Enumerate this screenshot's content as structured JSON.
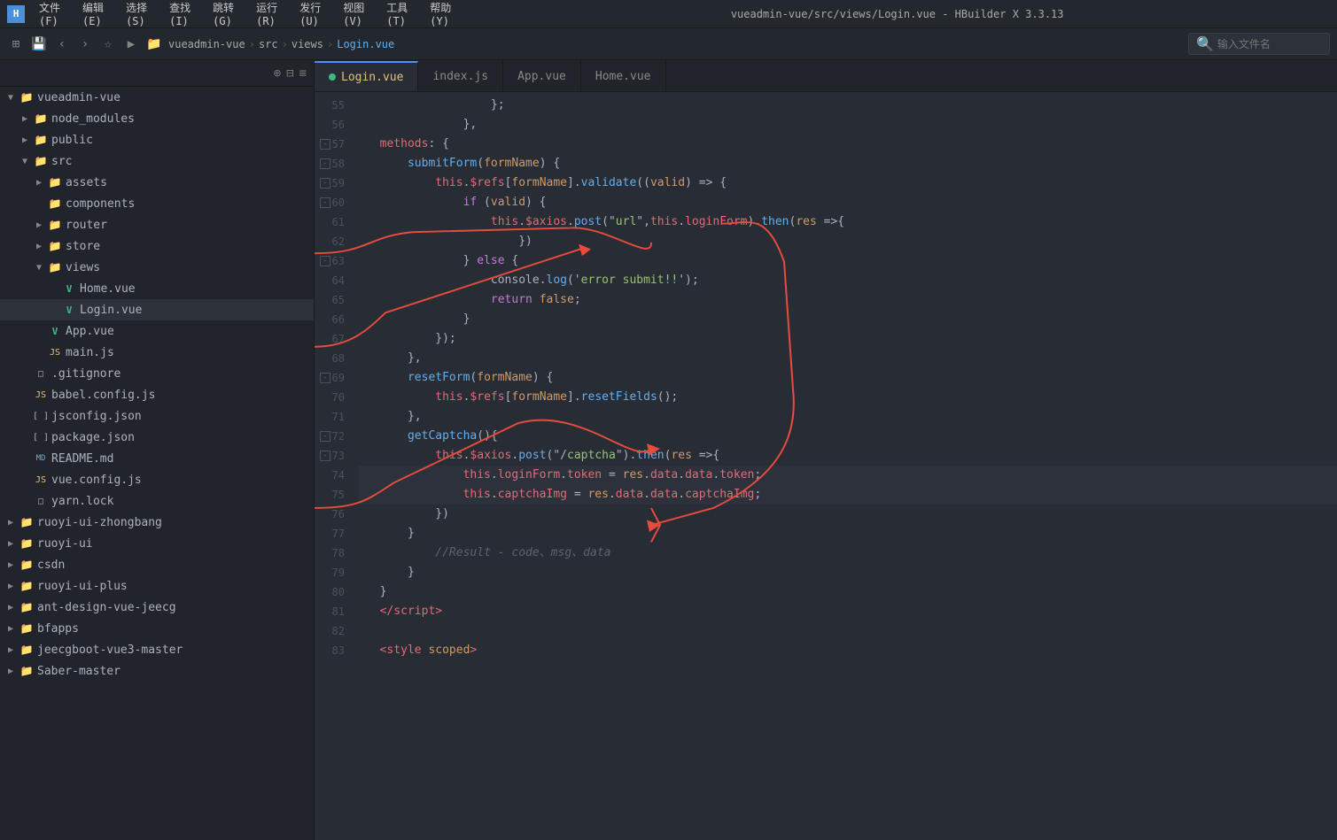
{
  "titlebar": {
    "logo": "H",
    "menu_items": [
      "文件(F)",
      "编辑(E)",
      "选择(S)",
      "查找(I)",
      "跳转(G)",
      "运行(R)",
      "发行(U)",
      "视图(V)",
      "工具(T)",
      "帮助(Y)"
    ],
    "title": "vueadmin-vue/src/views/Login.vue - HBuilder X 3.3.13"
  },
  "toolbar": {
    "breadcrumbs": [
      "vueadmin-vue",
      "src",
      "views",
      "Login.vue"
    ],
    "search_placeholder": "输入文件名"
  },
  "sidebar": {
    "root": "vueadmin-vue",
    "items": [
      {
        "id": "node_modules",
        "label": "node_modules",
        "type": "folder",
        "depth": 1,
        "expanded": false
      },
      {
        "id": "public",
        "label": "public",
        "type": "folder",
        "depth": 1,
        "expanded": false
      },
      {
        "id": "src",
        "label": "src",
        "type": "folder",
        "depth": 1,
        "expanded": true
      },
      {
        "id": "assets",
        "label": "assets",
        "type": "folder",
        "depth": 2,
        "expanded": false
      },
      {
        "id": "components",
        "label": "components",
        "type": "folder",
        "depth": 2,
        "expanded": false
      },
      {
        "id": "router",
        "label": "router",
        "type": "folder",
        "depth": 2,
        "expanded": false
      },
      {
        "id": "store",
        "label": "store",
        "type": "folder",
        "depth": 2,
        "expanded": false
      },
      {
        "id": "views",
        "label": "views",
        "type": "folder",
        "depth": 2,
        "expanded": true
      },
      {
        "id": "Home.vue",
        "label": "Home.vue",
        "type": "vue",
        "depth": 3
      },
      {
        "id": "Login.vue",
        "label": "Login.vue",
        "type": "vue",
        "depth": 3,
        "active": true
      },
      {
        "id": "App.vue",
        "label": "App.vue",
        "type": "vue",
        "depth": 2
      },
      {
        "id": "main.js",
        "label": "main.js",
        "type": "js",
        "depth": 2
      },
      {
        "id": ".gitignore",
        "label": ".gitignore",
        "type": "file",
        "depth": 1
      },
      {
        "id": "babel.config.js",
        "label": "babel.config.js",
        "type": "js",
        "depth": 1
      },
      {
        "id": "jsconfig.json",
        "label": "jsconfig.json",
        "type": "json",
        "depth": 1
      },
      {
        "id": "package.json",
        "label": "package.json",
        "type": "json",
        "depth": 1
      },
      {
        "id": "README.md",
        "label": "README.md",
        "type": "md",
        "depth": 1
      },
      {
        "id": "vue.config.js",
        "label": "vue.config.js",
        "type": "js",
        "depth": 1
      },
      {
        "id": "yarn.lock",
        "label": "yarn.lock",
        "type": "file",
        "depth": 1
      },
      {
        "id": "ruoyi-ui-zhongbang",
        "label": "ruoyi-ui-zhongbang",
        "type": "folder",
        "depth": 0,
        "expanded": false
      },
      {
        "id": "ruoyi-ui",
        "label": "ruoyi-ui",
        "type": "folder",
        "depth": 0,
        "expanded": false
      },
      {
        "id": "csdn",
        "label": "csdn",
        "type": "folder",
        "depth": 0,
        "expanded": false
      },
      {
        "id": "ruoyi-ui-plus",
        "label": "ruoyi-ui-plus",
        "type": "folder",
        "depth": 0,
        "expanded": false
      },
      {
        "id": "ant-design-vue-jeecg",
        "label": "ant-design-vue-jeecg",
        "type": "folder",
        "depth": 0,
        "expanded": false
      },
      {
        "id": "bfapps",
        "label": "bfapps",
        "type": "folder",
        "depth": 0,
        "expanded": false
      },
      {
        "id": "jeecgboot-vue3-master",
        "label": "jeecgboot-vue3-master",
        "type": "folder",
        "depth": 0,
        "expanded": false
      },
      {
        "id": "Saber-master",
        "label": "Saber-master",
        "type": "folder",
        "depth": 0,
        "expanded": false
      }
    ]
  },
  "tabs": [
    {
      "label": "Login.vue",
      "active": true,
      "type": "vue"
    },
    {
      "label": "index.js",
      "active": false,
      "type": "js"
    },
    {
      "label": "App.vue",
      "active": false,
      "type": "vue"
    },
    {
      "label": "Home.vue",
      "active": false,
      "type": "vue"
    }
  ],
  "code": {
    "lines": [
      {
        "num": 55,
        "collapse": false,
        "tokens": [
          {
            "t": "                  ",
            "c": "plain"
          },
          {
            "t": "}",
            "c": "punct"
          },
          {
            "t": ";",
            "c": "punct"
          }
        ]
      },
      {
        "num": 56,
        "collapse": false,
        "tokens": [
          {
            "t": "              ",
            "c": "plain"
          },
          {
            "t": "}",
            "c": "punct"
          },
          {
            "t": ",",
            "c": "punct"
          }
        ]
      },
      {
        "num": 57,
        "collapse": true,
        "tokens": [
          {
            "t": "  ",
            "c": "plain"
          },
          {
            "t": "methods",
            "c": "prop"
          },
          {
            "t": ": {",
            "c": "plain"
          }
        ]
      },
      {
        "num": 58,
        "collapse": true,
        "tokens": [
          {
            "t": "      ",
            "c": "plain"
          },
          {
            "t": "submitForm",
            "c": "fn"
          },
          {
            "t": "(",
            "c": "punct"
          },
          {
            "t": "formName",
            "c": "param"
          },
          {
            "t": ") {",
            "c": "plain"
          }
        ]
      },
      {
        "num": 59,
        "collapse": true,
        "tokens": [
          {
            "t": "          ",
            "c": "plain"
          },
          {
            "t": "this",
            "c": "this-kw"
          },
          {
            "t": ".",
            "c": "punct"
          },
          {
            "t": "$refs",
            "c": "prop"
          },
          {
            "t": "[",
            "c": "punct"
          },
          {
            "t": "formName",
            "c": "param"
          },
          {
            "t": "].",
            "c": "punct"
          },
          {
            "t": "validate",
            "c": "method"
          },
          {
            "t": "((",
            "c": "punct"
          },
          {
            "t": "valid",
            "c": "param"
          },
          {
            "t": ") => {",
            "c": "plain"
          }
        ]
      },
      {
        "num": 60,
        "collapse": true,
        "tokens": [
          {
            "t": "              ",
            "c": "plain"
          },
          {
            "t": "if",
            "c": "kw"
          },
          {
            "t": " (",
            "c": "punct"
          },
          {
            "t": "valid",
            "c": "param"
          },
          {
            "t": ") {",
            "c": "plain"
          }
        ]
      },
      {
        "num": 61,
        "collapse": false,
        "tokens": [
          {
            "t": "                  ",
            "c": "plain"
          },
          {
            "t": "this",
            "c": "this-kw"
          },
          {
            "t": ".",
            "c": "punct"
          },
          {
            "t": "$axios",
            "c": "prop"
          },
          {
            "t": ".",
            "c": "punct"
          },
          {
            "t": "post",
            "c": "method"
          },
          {
            "t": "(\"",
            "c": "punct"
          },
          {
            "t": "url",
            "c": "str"
          },
          {
            "t": "\",",
            "c": "punct"
          },
          {
            "t": "this",
            "c": "this-kw"
          },
          {
            "t": ".",
            "c": "punct"
          },
          {
            "t": "loginForm",
            "c": "prop"
          },
          {
            "t": ").",
            "c": "punct"
          },
          {
            "t": "then",
            "c": "method"
          },
          {
            "t": "(",
            "c": "punct"
          },
          {
            "t": "res",
            "c": "param"
          },
          {
            "t": " =>{",
            "c": "plain"
          }
        ]
      },
      {
        "num": 62,
        "collapse": false,
        "tokens": [
          {
            "t": "                      ",
            "c": "plain"
          },
          {
            "t": "})",
            "c": "punct"
          }
        ]
      },
      {
        "num": 63,
        "collapse": true,
        "tokens": [
          {
            "t": "              ",
            "c": "plain"
          },
          {
            "t": "} ",
            "c": "punct"
          },
          {
            "t": "else",
            "c": "kw"
          },
          {
            "t": " {",
            "c": "plain"
          }
        ]
      },
      {
        "num": 64,
        "collapse": false,
        "tokens": [
          {
            "t": "                  ",
            "c": "plain"
          },
          {
            "t": "console",
            "c": "plain"
          },
          {
            "t": ".",
            "c": "punct"
          },
          {
            "t": "log",
            "c": "method"
          },
          {
            "t": "('",
            "c": "punct"
          },
          {
            "t": "error submit!!",
            "c": "str"
          },
          {
            "t": "');",
            "c": "punct"
          }
        ]
      },
      {
        "num": 65,
        "collapse": false,
        "tokens": [
          {
            "t": "                  ",
            "c": "plain"
          },
          {
            "t": "return",
            "c": "kw"
          },
          {
            "t": " ",
            "c": "plain"
          },
          {
            "t": "false",
            "c": "bool"
          },
          {
            "t": ";",
            "c": "punct"
          }
        ]
      },
      {
        "num": 66,
        "collapse": false,
        "tokens": [
          {
            "t": "              ",
            "c": "plain"
          },
          {
            "t": "}",
            "c": "punct"
          }
        ]
      },
      {
        "num": 67,
        "collapse": false,
        "tokens": [
          {
            "t": "          ",
            "c": "plain"
          },
          {
            "t": "});",
            "c": "punct"
          }
        ]
      },
      {
        "num": 68,
        "collapse": false,
        "tokens": [
          {
            "t": "      ",
            "c": "plain"
          },
          {
            "t": "},",
            "c": "punct"
          }
        ]
      },
      {
        "num": 69,
        "collapse": true,
        "tokens": [
          {
            "t": "      ",
            "c": "plain"
          },
          {
            "t": "resetForm",
            "c": "fn"
          },
          {
            "t": "(",
            "c": "punct"
          },
          {
            "t": "formName",
            "c": "param"
          },
          {
            "t": ") {",
            "c": "plain"
          }
        ]
      },
      {
        "num": 70,
        "collapse": false,
        "tokens": [
          {
            "t": "          ",
            "c": "plain"
          },
          {
            "t": "this",
            "c": "this-kw"
          },
          {
            "t": ".",
            "c": "punct"
          },
          {
            "t": "$refs",
            "c": "prop"
          },
          {
            "t": "[",
            "c": "punct"
          },
          {
            "t": "formName",
            "c": "param"
          },
          {
            "t": "].",
            "c": "punct"
          },
          {
            "t": "resetFields",
            "c": "method"
          },
          {
            "t": "();",
            "c": "punct"
          }
        ]
      },
      {
        "num": 71,
        "collapse": false,
        "tokens": [
          {
            "t": "      ",
            "c": "plain"
          },
          {
            "t": "},",
            "c": "punct"
          }
        ]
      },
      {
        "num": 72,
        "collapse": true,
        "tokens": [
          {
            "t": "      ",
            "c": "plain"
          },
          {
            "t": "getCaptcha",
            "c": "fn"
          },
          {
            "t": "(){",
            "c": "plain"
          }
        ]
      },
      {
        "num": 73,
        "collapse": true,
        "tokens": [
          {
            "t": "          ",
            "c": "plain"
          },
          {
            "t": "this",
            "c": "this-kw"
          },
          {
            "t": ".",
            "c": "punct"
          },
          {
            "t": "$axios",
            "c": "prop"
          },
          {
            "t": ".",
            "c": "punct"
          },
          {
            "t": "post",
            "c": "method"
          },
          {
            "t": "(\"/",
            "c": "punct"
          },
          {
            "t": "captcha",
            "c": "str"
          },
          {
            "t": "\").",
            "c": "punct"
          },
          {
            "t": "then",
            "c": "method"
          },
          {
            "t": "(",
            "c": "punct"
          },
          {
            "t": "res",
            "c": "param"
          },
          {
            "t": " =>{",
            "c": "plain"
          }
        ]
      },
      {
        "num": 74,
        "collapse": false,
        "tokens": [
          {
            "t": "              ",
            "c": "plain"
          },
          {
            "t": "this",
            "c": "this-kw"
          },
          {
            "t": ".",
            "c": "punct"
          },
          {
            "t": "loginForm",
            "c": "prop"
          },
          {
            "t": ".",
            "c": "punct"
          },
          {
            "t": "token",
            "c": "prop"
          },
          {
            "t": " = ",
            "c": "plain"
          },
          {
            "t": "res",
            "c": "param"
          },
          {
            "t": ".",
            "c": "punct"
          },
          {
            "t": "data",
            "c": "prop"
          },
          {
            "t": ".",
            "c": "punct"
          },
          {
            "t": "data",
            "c": "prop"
          },
          {
            "t": ".",
            "c": "punct"
          },
          {
            "t": "token",
            "c": "prop"
          },
          {
            "t": ";",
            "c": "punct"
          }
        ]
      },
      {
        "num": 75,
        "collapse": false,
        "tokens": [
          {
            "t": "              ",
            "c": "plain"
          },
          {
            "t": "this",
            "c": "this-kw"
          },
          {
            "t": ".",
            "c": "punct"
          },
          {
            "t": "captchaImg",
            "c": "prop"
          },
          {
            "t": " = ",
            "c": "plain"
          },
          {
            "t": "res",
            "c": "param"
          },
          {
            "t": ".",
            "c": "punct"
          },
          {
            "t": "data",
            "c": "prop"
          },
          {
            "t": ".",
            "c": "punct"
          },
          {
            "t": "data",
            "c": "prop"
          },
          {
            "t": ".",
            "c": "punct"
          },
          {
            "t": "captchaImg",
            "c": "prop"
          },
          {
            "t": ";",
            "c": "punct"
          }
        ],
        "active": true
      },
      {
        "num": 76,
        "collapse": false,
        "tokens": [
          {
            "t": "          ",
            "c": "plain"
          },
          {
            "t": "})",
            "c": "punct"
          }
        ]
      },
      {
        "num": 77,
        "collapse": false,
        "tokens": [
          {
            "t": "      ",
            "c": "plain"
          },
          {
            "t": "}",
            "c": "punct"
          }
        ]
      },
      {
        "num": 78,
        "collapse": false,
        "tokens": [
          {
            "t": "          ",
            "c": "plain"
          },
          {
            "t": "//Result - code、msg、data",
            "c": "comment"
          }
        ]
      },
      {
        "num": 79,
        "collapse": false,
        "tokens": [
          {
            "t": "      ",
            "c": "plain"
          },
          {
            "t": "}",
            "c": "punct"
          }
        ]
      },
      {
        "num": 80,
        "collapse": false,
        "tokens": [
          {
            "t": "  ",
            "c": "plain"
          },
          {
            "t": "}",
            "c": "punct"
          }
        ]
      },
      {
        "num": 81,
        "collapse": false,
        "tokens": [
          {
            "t": "  ",
            "c": "plain"
          },
          {
            "t": "</",
            "c": "tag"
          },
          {
            "t": "script",
            "c": "tag"
          },
          {
            "t": ">",
            "c": "tag"
          }
        ]
      },
      {
        "num": 82,
        "collapse": false,
        "tokens": []
      },
      {
        "num": 83,
        "collapse": false,
        "tokens": [
          {
            "t": "  ",
            "c": "plain"
          },
          {
            "t": "<",
            "c": "tag"
          },
          {
            "t": "style",
            "c": "tag"
          },
          {
            "t": " ",
            "c": "plain"
          },
          {
            "t": "scoped",
            "c": "attr"
          },
          {
            "t": ">",
            "c": "tag"
          }
        ]
      }
    ]
  },
  "colors": {
    "bg_editor": "#282c34",
    "bg_sidebar": "#21252b",
    "bg_titlebar": "#23272e",
    "accent": "#528bff",
    "red_arrow": "#e74c3c"
  }
}
